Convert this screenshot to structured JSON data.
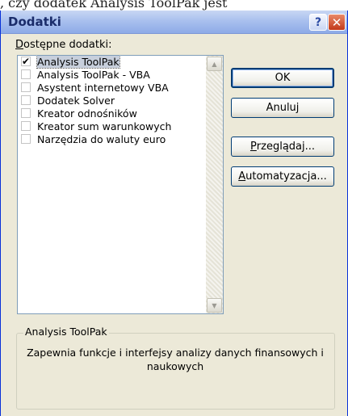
{
  "background_text": ", czy dodatek Analysis ToolPak jest",
  "dialog": {
    "title": "Dodatki",
    "help_symbol": "?",
    "close_symbol": "✕"
  },
  "list": {
    "label_mnemonic": "D",
    "label_rest": "ostępne dodatki:",
    "items": [
      {
        "label": "Analysis ToolPak",
        "checked": true,
        "selected": true
      },
      {
        "label": "Analysis ToolPak - VBA",
        "checked": false,
        "selected": false
      },
      {
        "label": "Asystent internetowy VBA",
        "checked": false,
        "selected": false
      },
      {
        "label": "Dodatek Solver",
        "checked": false,
        "selected": false
      },
      {
        "label": "Kreator odnośników",
        "checked": false,
        "selected": false
      },
      {
        "label": "Kreator sum warunkowych",
        "checked": false,
        "selected": false
      },
      {
        "label": "Narzędzia do waluty euro",
        "checked": false,
        "selected": false
      }
    ]
  },
  "buttons": {
    "ok": "OK",
    "cancel": "Anuluj",
    "browse_mnemonic": "P",
    "browse_rest": "rzeglądaj...",
    "automation_mnemonic": "A",
    "automation_rest": "utomatyzacja..."
  },
  "details": {
    "title": "Analysis ToolPak",
    "description": "Zapewnia funkcje i interfejsy analizy danych finansowych i naukowych"
  }
}
